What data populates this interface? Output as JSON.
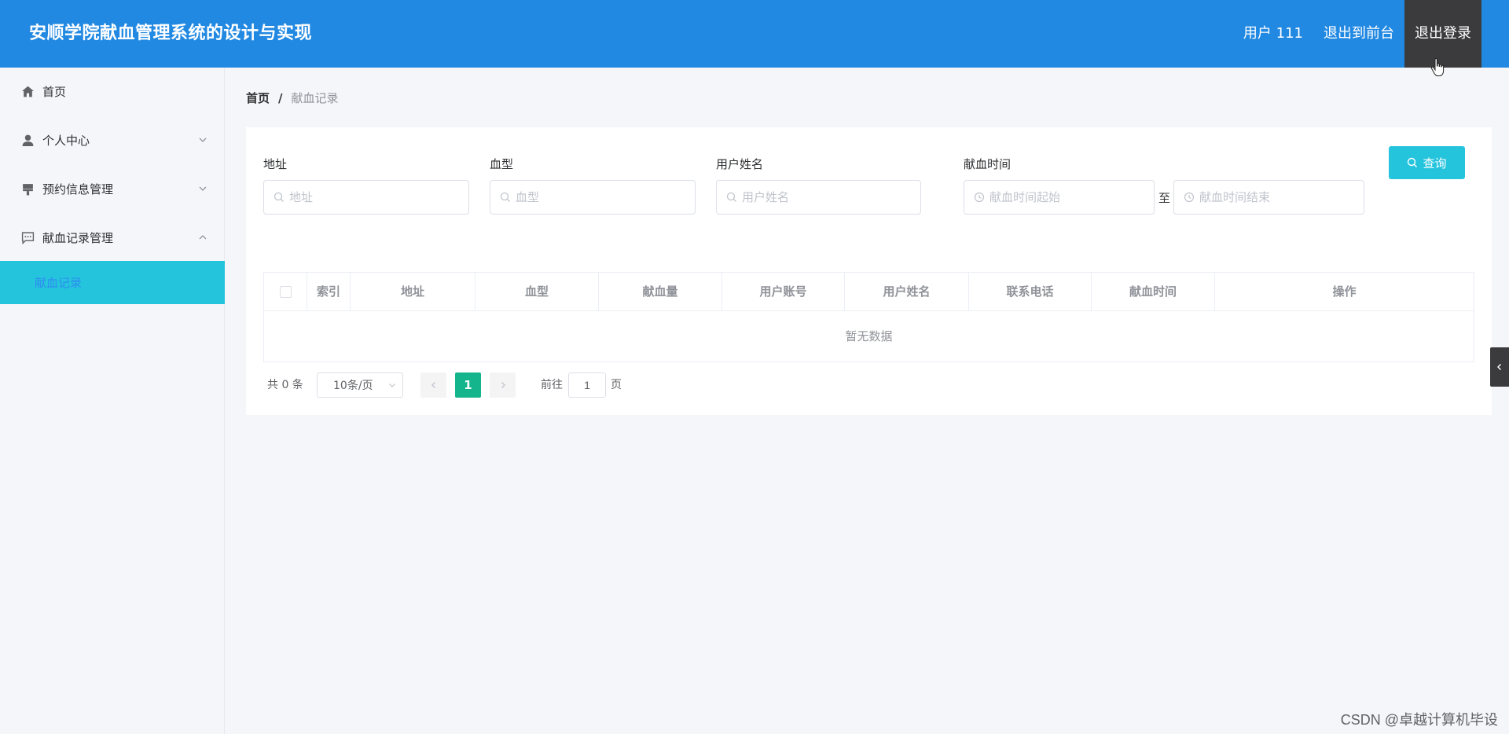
{
  "header": {
    "title": "安顺学院献血管理系统的设计与实现",
    "user_label": "用户 111",
    "front_label": "退出到前台",
    "logout_label": "退出登录"
  },
  "sidebar": {
    "items": [
      {
        "label": "首页",
        "icon": "home-icon"
      },
      {
        "label": "个人中心",
        "icon": "user-icon"
      },
      {
        "label": "预约信息管理",
        "icon": "brush-icon"
      },
      {
        "label": "献血记录管理",
        "icon": "chat-icon"
      }
    ],
    "active_sub": "献血记录"
  },
  "breadcrumb": {
    "home": "首页",
    "separator": "/",
    "current": "献血记录"
  },
  "search": {
    "address_label": "地址",
    "address_placeholder": "地址",
    "blood_type_label": "血型",
    "blood_type_placeholder": "血型",
    "user_name_label": "用户姓名",
    "user_name_placeholder": "用户姓名",
    "time_label": "献血时间",
    "time_start_placeholder": "献血时间起始",
    "time_range_sep": "至",
    "time_end_placeholder": "献血时间结束",
    "query_label": "查询"
  },
  "table": {
    "columns": [
      "索引",
      "地址",
      "血型",
      "献血量",
      "用户账号",
      "用户姓名",
      "联系电话",
      "献血时间",
      "操作"
    ],
    "empty_text": "暂无数据"
  },
  "pagination": {
    "total": "共 0 条",
    "page_size": "10条/页",
    "current_page": "1",
    "goto_prefix": "前往",
    "goto_value": "1",
    "goto_suffix": "页"
  },
  "watermark": "CSDN @卓越计算机毕设",
  "colors": {
    "header_bg": "#2289e2",
    "accent": "#25c4dd",
    "page_active": "#14b48d"
  }
}
